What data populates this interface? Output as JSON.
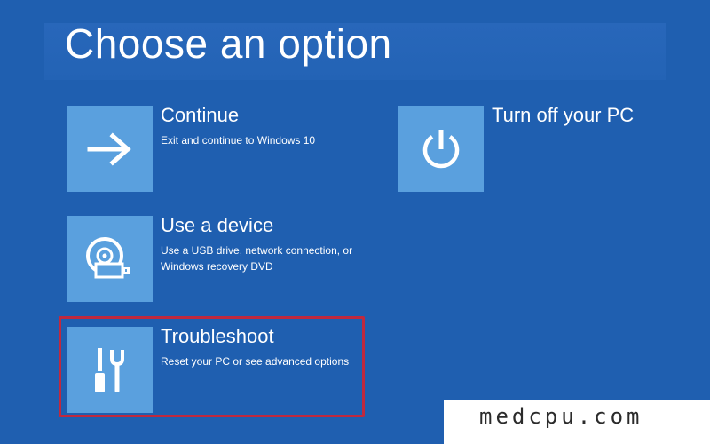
{
  "header": {
    "title": "Choose an option"
  },
  "options": {
    "continue": {
      "title": "Continue",
      "description": "Exit and continue to Windows 10",
      "icon": "arrow-right-icon"
    },
    "use_device": {
      "title": "Use a device",
      "description": "Use a USB drive, network connection, or Windows recovery DVD",
      "icon": "disc-drive-icon"
    },
    "troubleshoot": {
      "title": "Troubleshoot",
      "description": "Reset your PC or see advanced options",
      "icon": "tools-icon"
    },
    "turn_off": {
      "title": "Turn off your PC",
      "icon": "power-icon"
    }
  },
  "watermark": {
    "text": "medcpu.com"
  },
  "colors": {
    "background": "#1f5fb0",
    "tile": "#5aa0de",
    "highlight": "#c0293f",
    "text": "#ffffff"
  }
}
